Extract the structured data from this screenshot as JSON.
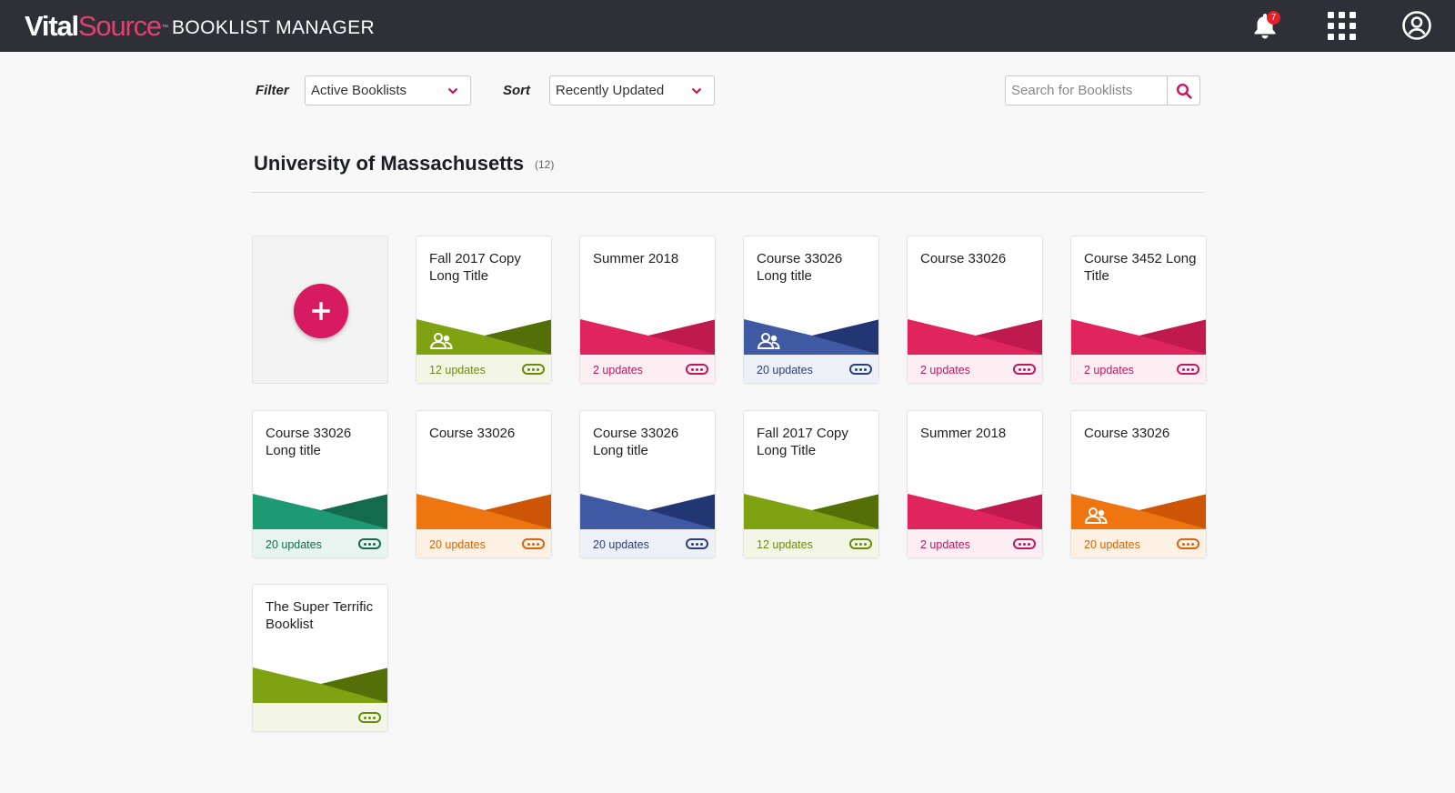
{
  "header": {
    "logo_part1": "Vital",
    "logo_part2": "Source",
    "logo_tm": "™",
    "app_title": "BOOKLIST MANAGER",
    "notification_count": "7"
  },
  "toolbar": {
    "filter_label": "Filter",
    "filter_value": "Active Booklists",
    "sort_label": "Sort",
    "sort_value": "Recently Updated",
    "search_placeholder": "Search for Booklists"
  },
  "section": {
    "title": "University of Massachusetts",
    "count": "(12)"
  },
  "colors": {
    "pink": {
      "light": "#e0245e",
      "dark": "#bf1a4f",
      "text": "#c2185b",
      "footer": "#fdeef3"
    },
    "olive": {
      "light": "#7fa213",
      "dark": "#546f08",
      "text": "#6a8a0e",
      "footer": "#f3f6e6"
    },
    "navy": {
      "light": "#3f5aa3",
      "dark": "#223674",
      "text": "#2b3f7c",
      "footer": "#edf0f7"
    },
    "teal": {
      "light": "#1e9a72",
      "dark": "#146a4d",
      "text": "#17684c",
      "footer": "#e8f4ef"
    },
    "orange": {
      "light": "#ee7510",
      "dark": "#cc5606",
      "text": "#d9650c",
      "footer": "#fdf1e6"
    }
  },
  "booklists": [
    {
      "title": "Fall 2017 Copy Long Title",
      "updates": "12 updates",
      "color": "olive",
      "shared": true
    },
    {
      "title": "Summer 2018",
      "updates": "2 updates",
      "color": "pink",
      "shared": false
    },
    {
      "title": "Course 33026 Long title",
      "updates": "20 updates",
      "color": "navy",
      "shared": true
    },
    {
      "title": "Course 33026",
      "updates": "2 updates",
      "color": "pink",
      "shared": false
    },
    {
      "title": "Course 3452 Long Title",
      "updates": "2 updates",
      "color": "pink",
      "shared": false
    },
    {
      "title": "Course 33026 Long title",
      "updates": "20 updates",
      "color": "teal",
      "shared": false
    },
    {
      "title": "Course 33026",
      "updates": "20 updates",
      "color": "orange",
      "shared": false
    },
    {
      "title": "Course 33026 Long title",
      "updates": "20 updates",
      "color": "navy",
      "shared": false
    },
    {
      "title": "Fall 2017 Copy Long Title",
      "updates": "12 updates",
      "color": "olive",
      "shared": false
    },
    {
      "title": "Summer 2018",
      "updates": "2 updates",
      "color": "pink",
      "shared": false
    },
    {
      "title": "Course 33026",
      "updates": "20 updates",
      "color": "orange",
      "shared": true
    },
    {
      "title": "The Super Terrific Booklist",
      "updates": "",
      "color": "olive",
      "shared": false
    }
  ],
  "icons": {
    "bell": "bell-icon",
    "apps": "apps-grid-icon",
    "account": "account-icon",
    "search": "search-icon",
    "chevron": "chevron-down-icon",
    "add": "plus-icon",
    "shared": "users-icon",
    "more": "more-options-icon"
  }
}
